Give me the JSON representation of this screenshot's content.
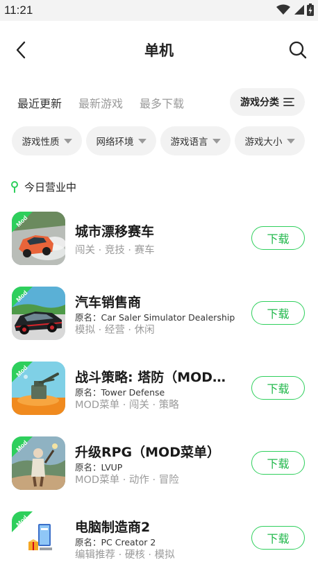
{
  "status_bar": {
    "time": "11:21"
  },
  "header": {
    "title": "单机"
  },
  "sort_tabs": [
    {
      "label": "最近更新",
      "active": true
    },
    {
      "label": "最新游戏",
      "active": false
    },
    {
      "label": "最多下载",
      "active": false
    }
  ],
  "category_button": {
    "label": "游戏分类"
  },
  "filters": [
    {
      "label": "游戏性质"
    },
    {
      "label": "网络环境"
    },
    {
      "label": "游戏语言"
    },
    {
      "label": "游戏大小"
    }
  ],
  "section": {
    "label": "今日营业中"
  },
  "games": [
    {
      "title": "城市漂移赛车",
      "original": "",
      "tags": "闯关 · 竞技 · 赛车",
      "mod_badge": "Mod",
      "download_label": "下载"
    },
    {
      "title": "汽车销售商",
      "original": "原名：Car Saler Simulator Dealership",
      "tags": "模拟 · 经营 · 休闲",
      "mod_badge": "Mod",
      "download_label": "下载"
    },
    {
      "title": "战斗策略: 塔防（MOD菜…",
      "original": "原名：Tower Defense",
      "tags": "MOD菜单 · 闯关 · 策略",
      "mod_badge": "Mod",
      "download_label": "下载"
    },
    {
      "title": "升级RPG（MOD菜单）",
      "original": "原名：LVUP",
      "tags": "MOD菜单 · 动作 · 冒险",
      "mod_badge": "Mod",
      "download_label": "下载"
    },
    {
      "title": "电脑制造商2",
      "original": "原名：PC Creator 2",
      "tags": "编辑推荐 · 硬核 · 模拟",
      "mod_badge": "Mod",
      "download_label": "下载"
    }
  ],
  "colors": {
    "accent": "#2ecf5c",
    "muted_text": "#9a9a9a",
    "chip_bg": "#f2f2f2"
  }
}
